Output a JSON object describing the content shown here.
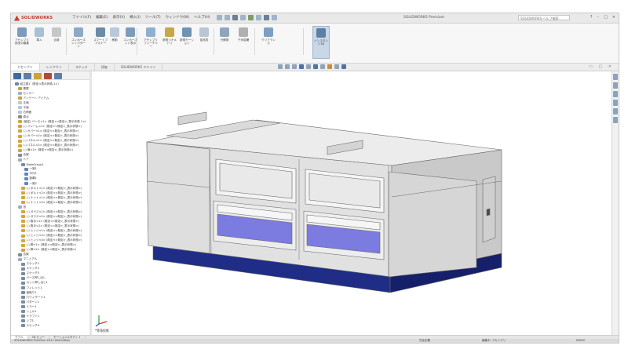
{
  "app": {
    "brand": "SOLIDWORKS",
    "document_title": "SOLIDWORKS Premium",
    "menu": [
      "ファイル(F)",
      "編集(E)",
      "表示(V)",
      "挿入(I)",
      "ツール(T)",
      "ウィンドウ(W)",
      "ヘルプ(H)"
    ],
    "search_placeholder": "SOLIDWORKS ヘルプ検索",
    "window_buttons": [
      "?",
      "–",
      "□",
      "×"
    ]
  },
  "ribbon": {
    "buttons": [
      {
        "label": "アセンブリ部品の編集",
        "color": "#7d9cbc"
      },
      {
        "label": "挿入",
        "color": "#a8bfd6"
      },
      {
        "label": "合致",
        "color": "#c7c7c7"
      },
      {
        "label": "コンポーネントパターン",
        "color": "#8fa9c4"
      },
      {
        "label": "スマートファスナー",
        "color": "#6d8ba8"
      },
      {
        "label": "移動",
        "color": "#b9c9d9"
      },
      {
        "label": "コンポーネント表示",
        "color": "#7d9cbc"
      },
      {
        "label": "アセンブリフィーチャー",
        "color": "#8fb0cf"
      },
      {
        "label": "参照ジオメトリ",
        "color": "#c8a64a"
      },
      {
        "label": "新規モーション",
        "color": "#6f92b5"
      },
      {
        "label": "部品表",
        "color": "#b8c6d4"
      },
      {
        "label": "分解図",
        "color": "#8fa5bc"
      },
      {
        "label": "干渉認識",
        "color": "#b0b0b0"
      },
      {
        "label": "クリアランス",
        "color": "#7c9fc2"
      },
      {
        "label": "インスタント3D",
        "color": "#5c7fa6"
      }
    ]
  },
  "tabs": [
    "アセンブリ",
    "レイアウト",
    "スケッチ",
    "評価",
    "SOLIDWORKS アドイン"
  ],
  "selected_tab": "アセンブリ",
  "tree": {
    "nodes": [
      {
        "label": "組立図1（既定<表示状態-1>）",
        "color": "#6b88a8"
      },
      {
        "label": "履歴",
        "color": "#c9a23a"
      },
      {
        "label": "センサー",
        "color": "#9bb3c9"
      },
      {
        "label": "アノテート アイテム",
        "color": "#c9a23a"
      },
      {
        "label": "正面",
        "color": "#b9c7d5"
      },
      {
        "label": "平面",
        "color": "#b9c7d5"
      },
      {
        "label": "右側面",
        "color": "#b9c7d5"
      },
      {
        "label": "原点",
        "color": "#8a8a8a"
      },
      {
        "label": "(固定) ベース<1> (既定<<既定>_表示状態 1>)",
        "color": "#d2a63c"
      },
      {
        "label": "(-) フレーム<1> (既定<<既定>_表示状態>)",
        "color": "#d2a63c"
      },
      {
        "label": "(-) カバー<1> (既定<<既定>_表示状態>)",
        "color": "#d2a63c"
      },
      {
        "label": "(-) カバー<2> (既定<<既定>_表示状態>)",
        "color": "#d2a63c"
      },
      {
        "label": "(-) パネル<1> (既定<<既定>_表示状態>)",
        "color": "#d2a63c"
      },
      {
        "label": "(-) パネル<2> (既定<<既定>_表示状態>)",
        "color": "#d2a63c"
      },
      {
        "label": "(-) 扉<1> (既定<<既定>_表示状態>)",
        "color": "#d2a63c"
      },
      {
        "label": "合致",
        "color": "#7a8c9e"
      },
      {
        "label": "ドア",
        "color": "#9aafc4"
      },
      {
        "label": "MateGroup1",
        "color": "#7a8c9e"
      },
      {
        "label": "一致1",
        "color": "#5f87b5"
      },
      {
        "label": "平行1",
        "color": "#5f87b5"
      },
      {
        "label": "距離1",
        "color": "#5f87b5"
      },
      {
        "label": "一致2",
        "color": "#5f87b5"
      },
      {
        "label": "(-) ボルト<1> (既定<<既定>_表示状態>)",
        "color": "#d2a63c"
      },
      {
        "label": "(-) ボルト<2> (既定<<既定>_表示状態>)",
        "color": "#d2a63c"
      },
      {
        "label": "(-) ナット<1> (既定<<既定>_表示状態>)",
        "color": "#d2a63c"
      },
      {
        "label": "(-) ナット<2> (既定<<既定>_表示状態>)",
        "color": "#d2a63c"
      },
      {
        "label": "窓",
        "color": "#9aafc4"
      },
      {
        "label": "(-) ガラス<1> (既定<<既定>_表示状態>)",
        "color": "#d2a63c"
      },
      {
        "label": "(-) ガラス<2> (既定<<既定>_表示状態>)",
        "color": "#d2a63c"
      },
      {
        "label": "(-) 取手<1> (既定<<既定>_表示状態>)",
        "color": "#d2a63c"
      },
      {
        "label": "(-) 取手<2> (既定<<既定>_表示状態>)",
        "color": "#d2a63c"
      },
      {
        "label": "(-) ヒンジ<1> (既定<<既定>_表示状態>)",
        "color": "#d2a63c"
      },
      {
        "label": "(-) ヒンジ<2> (既定<<既定>_表示状態>)",
        "color": "#d2a63c"
      },
      {
        "label": "(-) ヒンジ<3> (既定<<既定>_表示状態>)",
        "color": "#d2a63c"
      },
      {
        "label": "(-) 脚<1> (既定<<既定>_表示状態>)",
        "color": "#d2a63c"
      },
      {
        "label": "(-) 脚<2> (既定<<既定>_表示状態>)",
        "color": "#d2a63c"
      },
      {
        "label": "合致",
        "color": "#7a8c9e"
      },
      {
        "label": "マニュアル",
        "color": "#9aafc4"
      },
      {
        "label": "スケッチ1",
        "color": "#7a8c9e"
      },
      {
        "label": "スケッチ2",
        "color": "#7a8c9e"
      },
      {
        "label": "スケッチ3",
        "color": "#7a8c9e"
      },
      {
        "label": "ベース押し出し",
        "color": "#7a8c9e"
      },
      {
        "label": "カット押し出し1",
        "color": "#7a8c9e"
      },
      {
        "label": "フィレット1",
        "color": "#7a8c9e"
      },
      {
        "label": "面取り1",
        "color": "#7a8c9e"
      },
      {
        "label": "穴ウィザード1",
        "color": "#7a8c9e"
      },
      {
        "label": "パターン1",
        "color": "#7a8c9e"
      },
      {
        "label": "ミラー1",
        "color": "#7a8c9e"
      },
      {
        "label": "シェル1",
        "color": "#7a8c9e"
      },
      {
        "label": "ドラフト1",
        "color": "#7a8c9e"
      },
      {
        "label": "リブ1",
        "color": "#7a8c9e"
      },
      {
        "label": "スケッチ4",
        "color": "#7a8c9e"
      }
    ]
  },
  "viewport": {
    "view_label": "*等角投影",
    "machine_colors": {
      "body": "#e1e1e1",
      "body_dark": "#c9c9c9",
      "base": "#1f2d86",
      "window": "#7c7be0",
      "edge": "#6a6a6a"
    }
  },
  "bottom_tabs": [
    "モデル",
    "3D ビュー",
    "モーションスタディ 1"
  ],
  "status": {
    "left": "SOLIDWORKS Premium 2017 x64 Edition",
    "mid": "完全定義",
    "right": "編集中: アセンブリ",
    "units": "MMGS"
  }
}
